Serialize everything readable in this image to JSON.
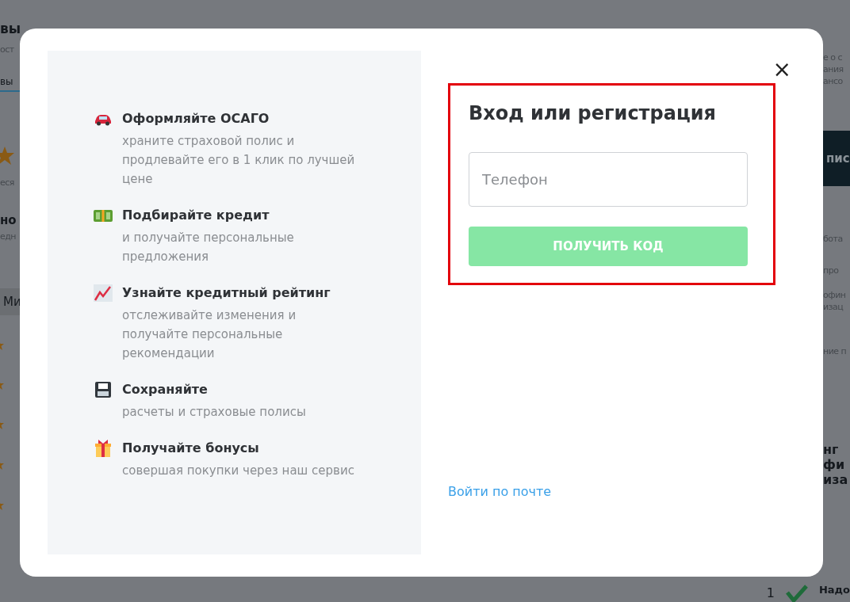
{
  "background": {
    "left_strip": [
      {
        "kind": "heading",
        "text": "вы"
      },
      {
        "kind": "text",
        "text": "ост"
      },
      {
        "kind": "tab",
        "text": "вы"
      },
      {
        "kind": "star"
      },
      {
        "kind": "text",
        "text": "еся"
      },
      {
        "kind": "subheading",
        "text": "но"
      },
      {
        "kind": "text",
        "text": "едн"
      },
      {
        "kind": "chip",
        "text": "Ми"
      },
      {
        "kind": "small-star"
      },
      {
        "kind": "small-star"
      },
      {
        "kind": "small-star"
      },
      {
        "kind": "small-star"
      },
      {
        "kind": "small-star"
      }
    ],
    "right_strip": [
      {
        "kind": "text",
        "text": "е о с"
      },
      {
        "kind": "text",
        "text": "ания"
      },
      {
        "kind": "text",
        "text": "ансо"
      },
      {
        "kind": "button",
        "text": "пис"
      },
      {
        "kind": "text",
        "text": "бота"
      },
      {
        "kind": "text",
        "text": "про"
      },
      {
        "kind": "text",
        "text": "офин"
      },
      {
        "kind": "text",
        "text": "изац"
      },
      {
        "kind": "text",
        "text": "ние п"
      },
      {
        "kind": "heading",
        "text": "нг"
      },
      {
        "kind": "heading",
        "text": "фи"
      },
      {
        "kind": "heading",
        "text": "иза"
      }
    ],
    "bottom_row": {
      "number": "1",
      "text": "Надо"
    }
  },
  "modal": {
    "features": [
      {
        "title": "Оформляйте ОСАГО",
        "description": "храните страховой полис и продлевайте его в 1 клик по лучшей цене"
      },
      {
        "title": "Подбирайте кредит",
        "description": "и получайте персональные предложения"
      },
      {
        "title": "Узнайте кредитный рейтинг",
        "description": "отслеживайте изменения и получайте персональные рекомендации"
      },
      {
        "title": "Сохраняйте",
        "description": "расчеты и страховые полисы"
      },
      {
        "title": "Получайте бонусы",
        "description": "совершая покупки через наш сервис"
      }
    ],
    "title": "Вход или регистрация",
    "phone": {
      "placeholder": "Телефон"
    },
    "submit": {
      "label": "ПОЛУЧИТЬ КОД",
      "disabled": true
    },
    "email_link": "Войти по почте",
    "close": "×"
  }
}
